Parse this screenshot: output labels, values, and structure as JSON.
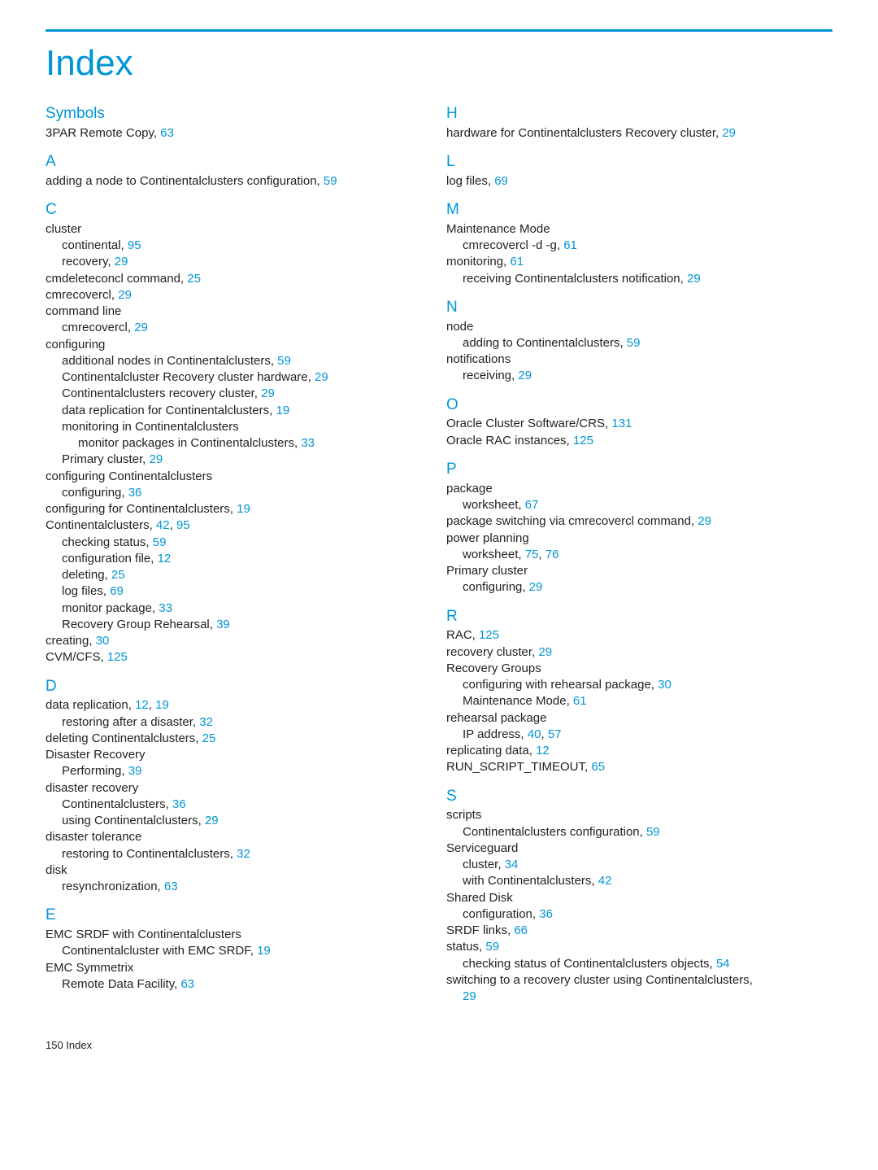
{
  "title": "Index",
  "footer": "150   Index",
  "leftSections": [
    {
      "letter": "Symbols",
      "entries": [
        {
          "lvl": 1,
          "text": "3PAR Remote Copy, ",
          "pages": [
            "63"
          ]
        }
      ]
    },
    {
      "letter": "A",
      "entries": [
        {
          "lvl": 1,
          "text": "adding a node to Continentalclusters configuration, ",
          "pages": [
            "59"
          ]
        }
      ]
    },
    {
      "letter": "C",
      "entries": [
        {
          "lvl": 1,
          "text": "cluster"
        },
        {
          "lvl": 2,
          "text": "continental, ",
          "pages": [
            "95"
          ]
        },
        {
          "lvl": 2,
          "text": "recovery, ",
          "pages": [
            "29"
          ]
        },
        {
          "lvl": 1,
          "text": "cmdeleteconcl command, ",
          "pages": [
            "25"
          ]
        },
        {
          "lvl": 1,
          "text": "cmrecovercl, ",
          "pages": [
            "29"
          ]
        },
        {
          "lvl": 1,
          "text": "command line"
        },
        {
          "lvl": 2,
          "text": "cmrecovercl, ",
          "pages": [
            "29"
          ]
        },
        {
          "lvl": 1,
          "text": "configuring"
        },
        {
          "lvl": 2,
          "text": "additional nodes in Continentalclusters, ",
          "pages": [
            "59"
          ]
        },
        {
          "lvl": 2,
          "text": "Continentalcluster Recovery cluster hardware, ",
          "pages": [
            "29"
          ]
        },
        {
          "lvl": 2,
          "text": "Continentalclusters recovery cluster, ",
          "pages": [
            "29"
          ]
        },
        {
          "lvl": 2,
          "text": "data replication for Continentalclusters, ",
          "pages": [
            "19"
          ]
        },
        {
          "lvl": 2,
          "text": "monitoring in Continentalclusters"
        },
        {
          "lvl": 3,
          "text": "monitor packages in Continentalclusters, ",
          "pages": [
            "33"
          ]
        },
        {
          "lvl": 2,
          "text": "Primary cluster, ",
          "pages": [
            "29"
          ]
        },
        {
          "lvl": 1,
          "text": "configuring Continentalclusters"
        },
        {
          "lvl": 2,
          "text": "configuring, ",
          "pages": [
            "36"
          ]
        },
        {
          "lvl": 1,
          "text": "configuring for Continentalclusters, ",
          "pages": [
            "19"
          ]
        },
        {
          "lvl": 1,
          "text": "Continentalclusters, ",
          "pages": [
            "42",
            "95"
          ]
        },
        {
          "lvl": 2,
          "text": "checking status, ",
          "pages": [
            "59"
          ]
        },
        {
          "lvl": 2,
          "text": "configuration file, ",
          "pages": [
            "12"
          ]
        },
        {
          "lvl": 2,
          "text": "deleting, ",
          "pages": [
            "25"
          ]
        },
        {
          "lvl": 2,
          "text": "log files, ",
          "pages": [
            "69"
          ]
        },
        {
          "lvl": 2,
          "text": "monitor package, ",
          "pages": [
            "33"
          ]
        },
        {
          "lvl": 2,
          "text": "Recovery Group Rehearsal, ",
          "pages": [
            "39"
          ]
        },
        {
          "lvl": 1,
          "text": "creating, ",
          "pages": [
            "30"
          ]
        },
        {
          "lvl": 1,
          "text": "CVM/CFS, ",
          "pages": [
            "125"
          ]
        }
      ]
    },
    {
      "letter": "D",
      "entries": [
        {
          "lvl": 1,
          "text": "data replication, ",
          "pages": [
            "12",
            "19"
          ]
        },
        {
          "lvl": 2,
          "text": "restoring after a disaster, ",
          "pages": [
            "32"
          ]
        },
        {
          "lvl": 1,
          "text": "deleting Continentalclusters, ",
          "pages": [
            "25"
          ]
        },
        {
          "lvl": 1,
          "text": "Disaster Recovery"
        },
        {
          "lvl": 2,
          "text": "Performing, ",
          "pages": [
            "39"
          ]
        },
        {
          "lvl": 1,
          "text": "disaster recovery"
        },
        {
          "lvl": 2,
          "text": "Continentalclusters, ",
          "pages": [
            "36"
          ]
        },
        {
          "lvl": 2,
          "text": "using Continentalclusters, ",
          "pages": [
            "29"
          ]
        },
        {
          "lvl": 1,
          "text": "disaster tolerance"
        },
        {
          "lvl": 2,
          "text": "restoring to Continentalclusters, ",
          "pages": [
            "32"
          ]
        },
        {
          "lvl": 1,
          "text": "disk"
        },
        {
          "lvl": 2,
          "text": "resynchronization, ",
          "pages": [
            "63"
          ]
        }
      ]
    },
    {
      "letter": "E",
      "entries": [
        {
          "lvl": 1,
          "text": "EMC SRDF with Continentalclusters"
        },
        {
          "lvl": 2,
          "text": "Continentalcluster with EMC SRDF, ",
          "pages": [
            "19"
          ]
        },
        {
          "lvl": 1,
          "text": "EMC Symmetrix"
        },
        {
          "lvl": 2,
          "text": "Remote Data Facility, ",
          "pages": [
            "63"
          ]
        }
      ]
    }
  ],
  "rightSections": [
    {
      "letter": "H",
      "entries": [
        {
          "lvl": 1,
          "text": "hardware for Continentalclusters Recovery cluster, ",
          "pages": [
            "29"
          ]
        }
      ]
    },
    {
      "letter": "L",
      "entries": [
        {
          "lvl": 1,
          "text": "log files, ",
          "pages": [
            "69"
          ]
        }
      ]
    },
    {
      "letter": "M",
      "entries": [
        {
          "lvl": 1,
          "text": "Maintenance Mode"
        },
        {
          "lvl": 2,
          "text": "cmrecovercl -d -g, ",
          "pages": [
            "61"
          ]
        },
        {
          "lvl": 1,
          "text": "monitoring, ",
          "pages": [
            "61"
          ]
        },
        {
          "lvl": 2,
          "text": "receiving Continentalclusters notification, ",
          "pages": [
            "29"
          ]
        }
      ]
    },
    {
      "letter": "N",
      "entries": [
        {
          "lvl": 1,
          "text": "node"
        },
        {
          "lvl": 2,
          "text": "adding to Continentalclusters, ",
          "pages": [
            "59"
          ]
        },
        {
          "lvl": 1,
          "text": "notifications"
        },
        {
          "lvl": 2,
          "text": "receiving, ",
          "pages": [
            "29"
          ]
        }
      ]
    },
    {
      "letter": "O",
      "entries": [
        {
          "lvl": 1,
          "text": "Oracle Cluster Software/CRS, ",
          "pages": [
            "131"
          ]
        },
        {
          "lvl": 1,
          "text": "Oracle RAC instances, ",
          "pages": [
            "125"
          ]
        }
      ]
    },
    {
      "letter": "P",
      "entries": [
        {
          "lvl": 1,
          "text": "package"
        },
        {
          "lvl": 2,
          "text": "worksheet, ",
          "pages": [
            "67"
          ]
        },
        {
          "lvl": 1,
          "text": "package switching via cmrecovercl command, ",
          "pages": [
            "29"
          ]
        },
        {
          "lvl": 1,
          "text": "power planning"
        },
        {
          "lvl": 2,
          "text": "worksheet, ",
          "pages": [
            "75",
            "76"
          ]
        },
        {
          "lvl": 1,
          "text": "Primary cluster"
        },
        {
          "lvl": 2,
          "text": "configuring, ",
          "pages": [
            "29"
          ]
        }
      ]
    },
    {
      "letter": "R",
      "entries": [
        {
          "lvl": 1,
          "text": "RAC, ",
          "pages": [
            "125"
          ]
        },
        {
          "lvl": 1,
          "text": "recovery cluster, ",
          "pages": [
            "29"
          ]
        },
        {
          "lvl": 1,
          "text": "Recovery Groups"
        },
        {
          "lvl": 2,
          "text": "configuring with rehearsal package, ",
          "pages": [
            "30"
          ]
        },
        {
          "lvl": 2,
          "text": "Maintenance Mode, ",
          "pages": [
            "61"
          ]
        },
        {
          "lvl": 1,
          "text": "rehearsal package"
        },
        {
          "lvl": 2,
          "text": "IP address, ",
          "pages": [
            "40",
            "57"
          ]
        },
        {
          "lvl": 1,
          "text": "replicating data, ",
          "pages": [
            "12"
          ]
        },
        {
          "lvl": 1,
          "text": "RUN_SCRIPT_TIMEOUT, ",
          "pages": [
            "65"
          ]
        }
      ]
    },
    {
      "letter": "S",
      "entries": [
        {
          "lvl": 1,
          "text": "scripts"
        },
        {
          "lvl": 2,
          "text": "Continentalclusters configuration, ",
          "pages": [
            "59"
          ]
        },
        {
          "lvl": 1,
          "text": "Serviceguard"
        },
        {
          "lvl": 2,
          "text": "cluster, ",
          "pages": [
            "34"
          ]
        },
        {
          "lvl": 2,
          "text": "with Continentalclusters, ",
          "pages": [
            "42"
          ]
        },
        {
          "lvl": 1,
          "text": "Shared Disk"
        },
        {
          "lvl": 2,
          "text": "configuration, ",
          "pages": [
            "36"
          ]
        },
        {
          "lvl": 1,
          "text": "SRDF links, ",
          "pages": [
            "66"
          ]
        },
        {
          "lvl": 1,
          "text": "status, ",
          "pages": [
            "59"
          ]
        },
        {
          "lvl": 2,
          "text": "checking status of Continentalclusters objects, ",
          "pages": [
            "54"
          ]
        },
        {
          "lvl": 1,
          "text": "switching to a recovery cluster using Continentalclusters, ",
          "pages": [
            "29"
          ],
          "pageonnext": true
        }
      ]
    }
  ]
}
